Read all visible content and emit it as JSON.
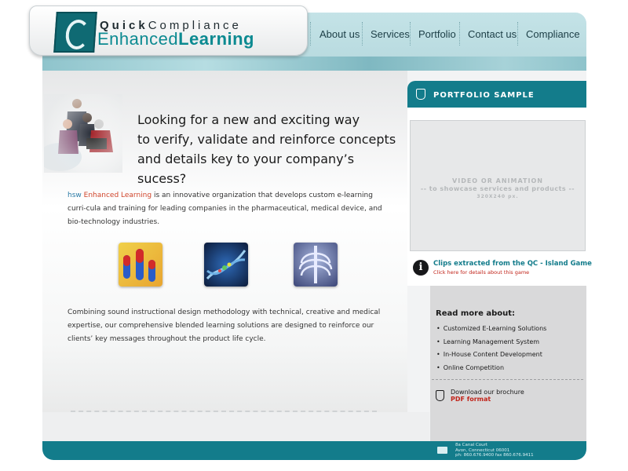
{
  "logo": {
    "top_bold": "Quick",
    "top_rest": "Compliance",
    "bottom_a": "Enhanced",
    "bottom_b": "Learning"
  },
  "nav": {
    "items": [
      {
        "label": "About us"
      },
      {
        "label": "Services"
      },
      {
        "label": "Portfolio"
      },
      {
        "label": "Contact us"
      },
      {
        "label": "Compliance"
      }
    ]
  },
  "hero": {
    "lines": [
      "Looking for a new and exciting way",
      "to verify, validate and reinforce concepts",
      "and details key to your company’s sucess?"
    ]
  },
  "intro": {
    "brand_a": "hsw",
    "brand_b": "Enhanced Learning",
    "text": "is an innovative organization that develops custom e-learning curri-cula and training for leading companies in the pharmaceutical, medical device, and bio-technology industries."
  },
  "body2": {
    "text": "Combining sound instructional design methodology with technical, creative and medical expertise, our comprehensive blended learning solutions are designed to reinforce our clients’ key messages throughout the product life cycle."
  },
  "portfolio": {
    "title": "PORTFOLIO SAMPLE",
    "video_line1": "VIDEO OR ANIMATION",
    "video_line2": "-- to showcase services and products --",
    "video_line3": "320X240 px.",
    "clips_title": "Clips extracted from the QC - Island Game",
    "clips_link": "Click here for details about this game",
    "info_glyph": "i"
  },
  "readmore": {
    "title": "Read more about:",
    "items": [
      {
        "label": "Customized E-Learning Solutions"
      },
      {
        "label": "Learning Management System"
      },
      {
        "label": "In-House Content Development"
      },
      {
        "label": "Online Competition"
      }
    ]
  },
  "brochure": {
    "text": "Download our brochure",
    "link": "PDF format"
  },
  "footer": {
    "line1": "8a Canal Court",
    "line2": "Avon, Connecticut 06001",
    "line3": "ph: 860.676.9400 fax 860.676.9411"
  },
  "colors": {
    "teal": "#137c8b",
    "accent_red": "#c1241a"
  }
}
